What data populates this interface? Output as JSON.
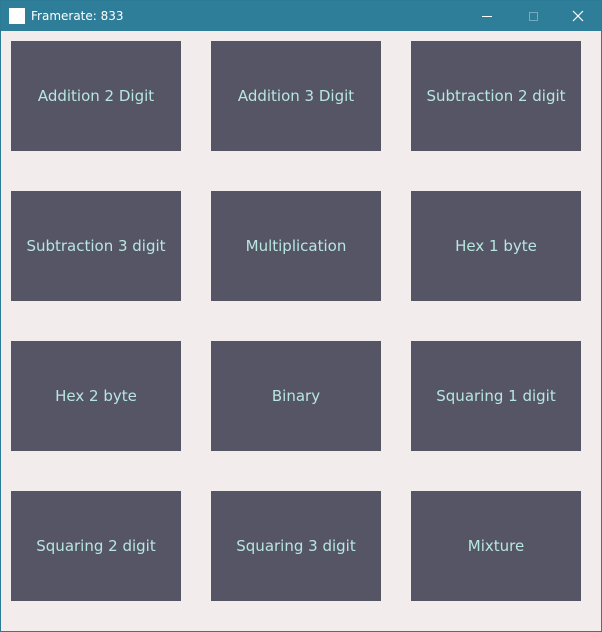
{
  "window": {
    "title": "Framerate: 833",
    "controls": {
      "minimize": "minimize-icon",
      "maximize": "maximize-icon",
      "close": "close-icon"
    }
  },
  "colors": {
    "titlebar": "#2e7d99",
    "background": "#f3ecec",
    "tile": "#555566",
    "tile_text": "#b8e6e0"
  },
  "tiles": [
    {
      "label": "Addition 2 Digit"
    },
    {
      "label": "Addition 3 Digit"
    },
    {
      "label": "Subtraction 2 digit"
    },
    {
      "label": "Subtraction 3 digit"
    },
    {
      "label": "Multiplication"
    },
    {
      "label": "Hex 1 byte"
    },
    {
      "label": "Hex 2 byte"
    },
    {
      "label": "Binary"
    },
    {
      "label": "Squaring 1 digit"
    },
    {
      "label": "Squaring 2 digit"
    },
    {
      "label": "Squaring 3 digit"
    },
    {
      "label": "Mixture"
    }
  ]
}
